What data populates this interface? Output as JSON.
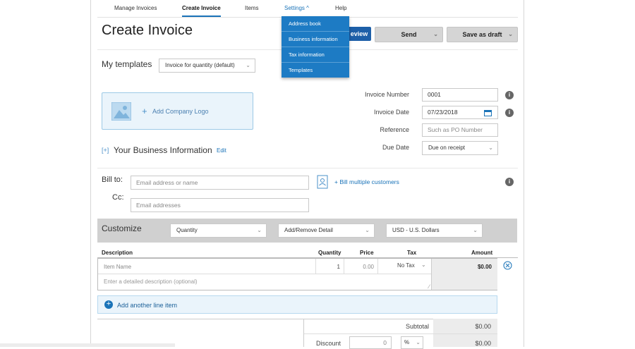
{
  "nav": {
    "manage_invoices": "Manage Invoices",
    "create_invoice": "Create Invoice",
    "items": "Items",
    "settings": "Settings",
    "help": "Help"
  },
  "settings_menu": [
    "Address book",
    "Business information",
    "Tax information",
    "Templates"
  ],
  "page_title": "Create Invoice",
  "toolbar": {
    "preview": "eview",
    "send": "Send",
    "save_draft": "Save as draft"
  },
  "templates": {
    "label": "My templates",
    "selected": "Invoice for quantity (default)"
  },
  "logo": {
    "label": "Add Company Logo"
  },
  "business": {
    "label": "Your Business Information",
    "edit": "Edit",
    "expander": "[+]"
  },
  "invoice_meta": {
    "number_label": "Invoice Number",
    "number_value": "0001",
    "date_label": "Invoice Date",
    "date_value": "07/23/2018",
    "reference_label": "Reference",
    "reference_placeholder": "Such as PO Number",
    "due_label": "Due Date",
    "due_value": "Due on receipt"
  },
  "bill": {
    "bill_to_label": "Bill to:",
    "bill_to_placeholder": "Email address or name",
    "cc_label": "Cc:",
    "cc_placeholder": "Email addresses",
    "multiple_label": "+ Bill multiple customers"
  },
  "customize": {
    "label": "Customize",
    "quantity": "Quantity",
    "detail": "Add/Remove Detail",
    "currency": "USD - U.S. Dollars"
  },
  "table": {
    "headers": {
      "description": "Description",
      "quantity": "Quantity",
      "price": "Price",
      "tax": "Tax",
      "amount": "Amount"
    },
    "row": {
      "item_placeholder": "Item Name",
      "quantity": "1",
      "price": "0.00",
      "tax": "No Tax",
      "amount": "$0.00",
      "detail_placeholder": "Enter a detailed description (optional)"
    },
    "add_line": "Add another line item"
  },
  "totals": {
    "subtotal_label": "Subtotal",
    "subtotal_value": "$0.00",
    "discount_label": "Discount",
    "discount_input": "0",
    "discount_type": "%",
    "discount_value": "$0.00"
  }
}
